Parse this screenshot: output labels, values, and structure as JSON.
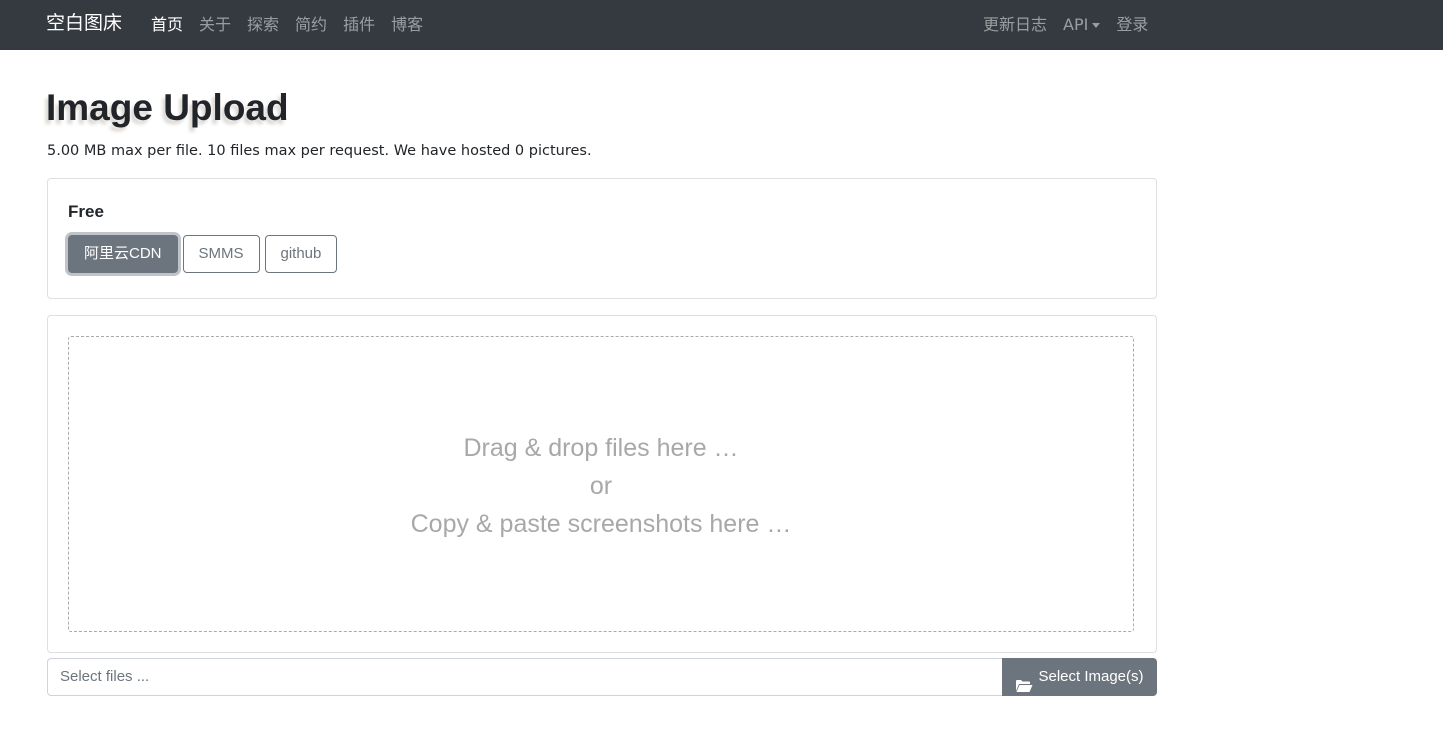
{
  "navbar": {
    "brand": "空白图床",
    "left_items": [
      {
        "label": "首页",
        "active": true
      },
      {
        "label": "关于",
        "active": false
      },
      {
        "label": "探索",
        "active": false
      },
      {
        "label": "简约",
        "active": false
      },
      {
        "label": "插件",
        "active": false
      },
      {
        "label": "博客",
        "active": false
      }
    ],
    "right_items": {
      "changelog": "更新日志",
      "api": "API",
      "login": "登录"
    }
  },
  "header": {
    "title": "Image Upload",
    "subtitle": "5.00 MB max per file. 10 files max per request. We have hosted 0 pictures."
  },
  "server_select": {
    "label": "Free",
    "options": [
      {
        "label": "阿里云CDN",
        "active": true
      },
      {
        "label": "SMMS",
        "active": false
      },
      {
        "label": "github",
        "active": false
      }
    ]
  },
  "dropzone": {
    "line1": "Drag & drop files here …",
    "line2": "or",
    "line3": "Copy & paste screenshots here …"
  },
  "file_input": {
    "placeholder": "Select files ...",
    "button_label": "Select Image(s)",
    "button_icon": "folder-open-icon"
  },
  "colors": {
    "navbar_bg": "#343a40",
    "secondary": "#6c757d"
  }
}
